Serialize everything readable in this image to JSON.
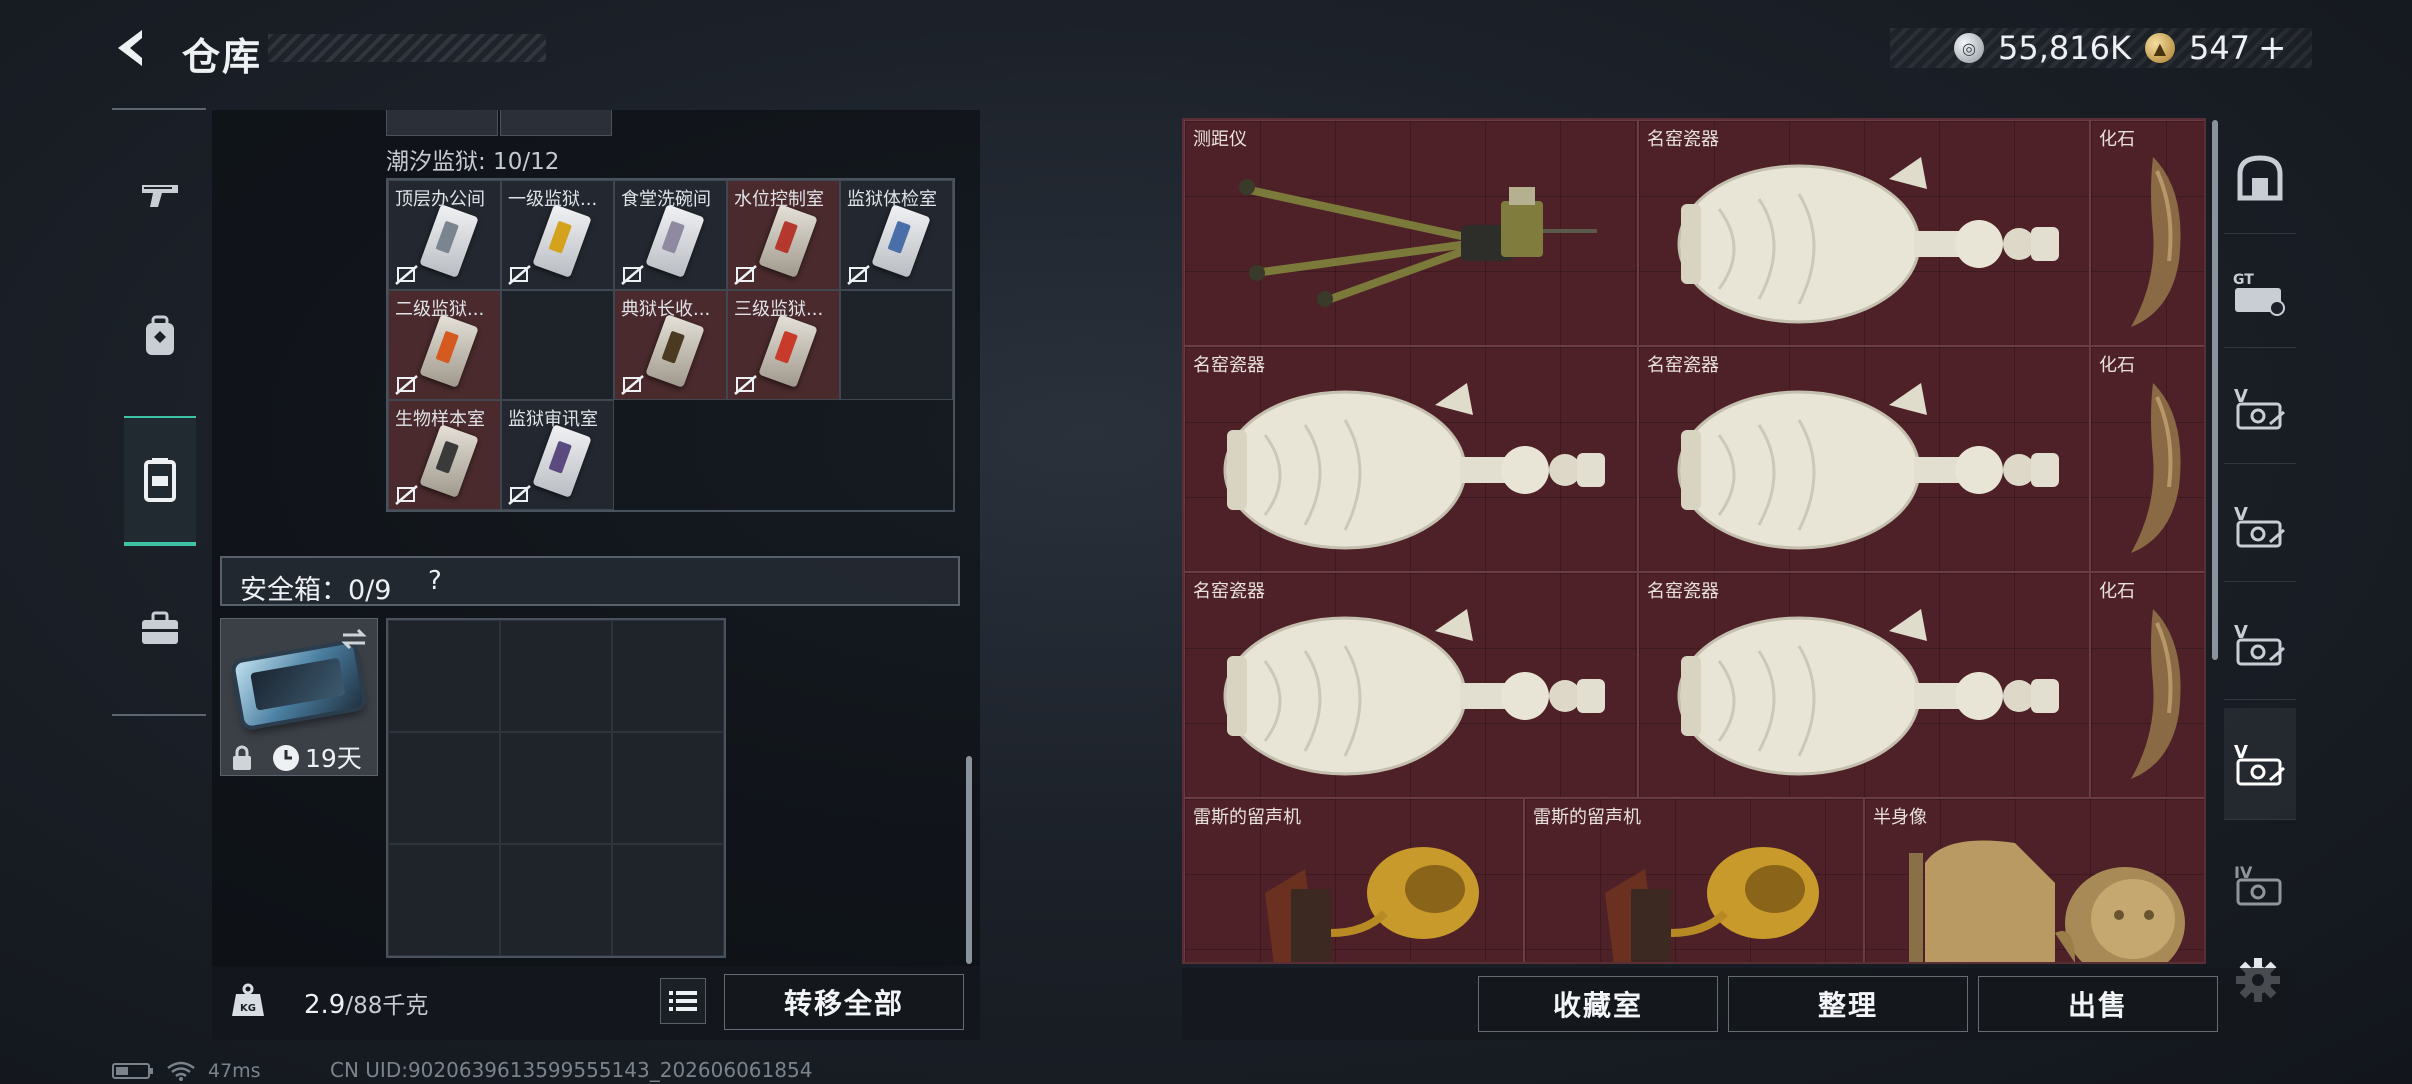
{
  "header": {
    "title": "仓库",
    "currency": [
      {
        "icon": "silver-coin-icon",
        "value": "55,816K"
      },
      {
        "icon": "gold-coin-icon",
        "value": "547"
      }
    ],
    "add_label": "+"
  },
  "left_tabs": [
    {
      "icon": "pistol-icon"
    },
    {
      "icon": "backpack-icon"
    },
    {
      "icon": "keycard-case-icon",
      "active": true
    },
    {
      "icon": "toolbox-icon"
    }
  ],
  "key_section": {
    "map_label": "潮汐监狱: 10/12",
    "keys": [
      {
        "name": "顶层办公间",
        "bg": "dark",
        "card": "white",
        "stripe": "#7b8590"
      },
      {
        "name": "一级监狱...",
        "bg": "dark",
        "card": "white",
        "stripe": "#d4a21c"
      },
      {
        "name": "食堂洗碗间",
        "bg": "dark",
        "card": "white",
        "stripe": "#8f8aa0"
      },
      {
        "name": "水位控制室",
        "bg": "red",
        "card": "white",
        "stripe": "#b4382e"
      },
      {
        "name": "监狱体检室",
        "bg": "dark",
        "card": "white",
        "stripe": "#4a6fa8"
      },
      {
        "name": "二级监狱...",
        "bg": "red",
        "card": "white",
        "stripe": "#d45a20"
      },
      {
        "name": "",
        "bg": "empty"
      },
      {
        "name": "典狱长收...",
        "bg": "red",
        "card": "gold",
        "stripe": "#4a3a22"
      },
      {
        "name": "三级监狱...",
        "bg": "red",
        "card": "white",
        "stripe": "#c83a2a"
      },
      {
        "name": "",
        "bg": "empty"
      },
      {
        "name": "生物样本室",
        "bg": "red",
        "card": "gold",
        "stripe": "#3a3a3a"
      },
      {
        "name": "监狱审讯室",
        "bg": "dark",
        "card": "white",
        "stripe": "#5a4a80"
      }
    ]
  },
  "safe_box": {
    "label": "安全箱：0/9",
    "help": "?",
    "item_days": "19天"
  },
  "inventory": {
    "weight_current": "2.9",
    "weight_max": "/88千克",
    "transfer_all": "转移全部"
  },
  "stash": {
    "items": [
      {
        "name": "测距仪",
        "icon": "rangefinder-icon"
      },
      {
        "name": "名窑瓷器",
        "icon": "porcelain-vase-icon"
      },
      {
        "name": "化石",
        "icon": "fossil-claw-icon"
      },
      {
        "name": "名窑瓷器",
        "icon": "porcelain-vase-icon"
      },
      {
        "name": "名窑瓷器",
        "icon": "porcelain-vase-icon"
      },
      {
        "name": "化石",
        "icon": "fossil-claw-icon"
      },
      {
        "name": "名窑瓷器",
        "icon": "porcelain-vase-icon"
      },
      {
        "name": "名窑瓷器",
        "icon": "porcelain-vase-icon"
      },
      {
        "name": "化石",
        "icon": "fossil-claw-icon"
      },
      {
        "name": "雷斯的留声机",
        "icon": "gramophone-icon"
      },
      {
        "name": "雷斯的留声机",
        "icon": "gramophone-icon"
      },
      {
        "name": "半身像",
        "icon": "bust-statue-icon"
      }
    ]
  },
  "right_tabs": [
    {
      "icon": "vault-icon"
    },
    {
      "icon": "g-level-case-icon"
    },
    {
      "icon": "v-case-icon"
    },
    {
      "icon": "v-case-icon"
    },
    {
      "icon": "v-case-icon"
    },
    {
      "icon": "v-case-icon",
      "active": true
    },
    {
      "icon": "iv-case-icon"
    }
  ],
  "stash_actions": {
    "collection": "收藏室",
    "sort": "整理",
    "sell": "出售"
  },
  "status": {
    "ping": "47ms",
    "uid": "CN UID:9020639613599555143_202606061854"
  }
}
